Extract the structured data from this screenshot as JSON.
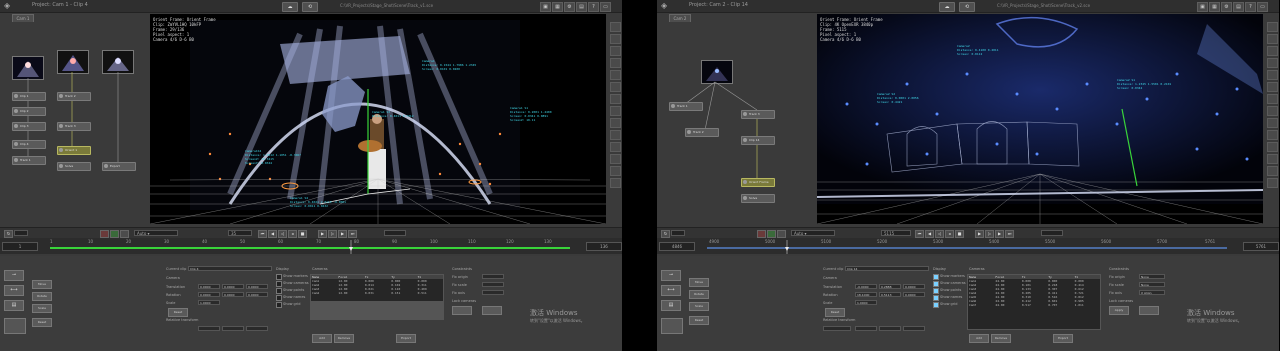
{
  "left": {
    "title": "Project: Cam 1 - Clip 4",
    "file": "C:\\VR_Projects\\Stage_Shot\\Scene\\Track_v1.sce",
    "subtab": "Cam 1",
    "timecode": "35",
    "frame_start": "1",
    "frame_end": "136",
    "ruler": [
      "1",
      "10",
      "20",
      "30",
      "40",
      "50",
      "60",
      "70",
      "80",
      "90",
      "100",
      "110",
      "120",
      "130",
      "136"
    ],
    "viewer_info": [
      "Orient Frame: Orient Frame",
      "Clip: ZmYVL1HQ 10kFP",
      "Frame: 29/136",
      "Pixel aspect: 1",
      "Camera 4/6 D-6 B0"
    ],
    "annotations": [
      "Camera1\nDistance: 0.1544 1.7986 1.2345\nScreen: 0.0101 0.0200",
      "Camera1 S1\nDistance: 0.2001 1.4400\nScreen: 0.0341 0.0891\nScreenZ: 10.11",
      "Camera1S2\nDistance: 1.9512 1.1051 -0.3067\nScreenZ: 10.3415\nScreenY: 0.0344",
      "Camera1 S3\nDistance: 0.4011 0.5312",
      "Camera1 S4\nDistance: 0.4021 2.0110 -0.0001\nScreen: 0.0011 0.0432"
    ],
    "nodes": [
      "Clip 1",
      "Clip 2",
      "Clip 3",
      "Clip 4",
      "Track 1",
      "Track 2",
      "Track 3",
      "Orient 1",
      "Solve",
      "Export"
    ],
    "props": {
      "current_clip_label": "Current clip",
      "current_clip": "Clip 4",
      "camera_label": "Camera",
      "translation_label": "Translation",
      "rotation_label": "Rotation",
      "scale_label": "Scale",
      "reset": "Reset",
      "relative_label": "Relative transform",
      "translation_x": "0.0000",
      "translation_y": "0.0000",
      "translation_z": "0.0000",
      "rot_x": "0.0000",
      "rot_y": "0.0000",
      "rot_z": "0.0000",
      "scale": "1.0000",
      "display_header": "Display",
      "display_items": [
        "Show markers",
        "Show cameras",
        "Show points",
        "Show names",
        "Show grid"
      ],
      "camera_table_header": "Cameras",
      "table_head": [
        "Name",
        "Focal",
        "Tx",
        "Ty",
        "Tz"
      ],
      "table_rows": [
        [
          "Cam1",
          "12.00",
          "0.000",
          "0.000",
          "0.000"
        ],
        [
          "Cam2",
          "12.00",
          "0.014",
          "0.102",
          "0.311"
        ],
        [
          "Cam3",
          "12.00",
          "0.021",
          "0.110",
          "0.409"
        ],
        [
          "Cam4",
          "12.00",
          "0.031",
          "0.151",
          "0.511"
        ]
      ],
      "table_btns": [
        "Add",
        "Remove",
        "Export"
      ],
      "constraints_header": "Constraints",
      "constraint_rows": [
        "Fix origin",
        "Fix scale",
        "Fix axis",
        "Lock cameras"
      ],
      "side_buttons": [
        "Move",
        "Rotate",
        "Scale",
        "Reset"
      ]
    }
  },
  "right": {
    "title": "Project: Cam 2 - Clip 14",
    "file": "C:\\VR_Projects\\Stage_Shot\\Scene\\Track_v2.sce",
    "subtab": "Cam 2",
    "timecode": "5115",
    "frame_start": "4846",
    "frame_end": "5761",
    "ruler": [
      "4900",
      "5000",
      "5100",
      "5200",
      "5300",
      "5400",
      "5500",
      "5600",
      "5700",
      "5761"
    ],
    "viewer_info": [
      "Orient Frame: Orient Frame",
      "Clip: 4K OpenEXR 3840p",
      "Frame: 5115",
      "Pixel aspect: 1",
      "Camera 4/6 D-6 B0"
    ],
    "annotations": [
      "Camera2\nDistance: 0.4100 0.2011\nScreen: 0.0112",
      "Camera2 S1\nDistance: 1.2345 1.5501 0.2101\nScreen: 0.0342",
      "Camera2 S2\nDistance: 0.0001 2.0056\nScreen: 0.4421"
    ],
    "nodes": [
      "Clip 14",
      "Track 1",
      "Track 2",
      "Track 3",
      "Orient Frame",
      "Solve"
    ],
    "props": {
      "current_clip_label": "Current clip",
      "current_clip": "Clip 14",
      "camera_label": "Camera",
      "translation_label": "Translation",
      "rotation_label": "Rotation",
      "scale_label": "Scale",
      "reset": "Reset",
      "relative_label": "Relative transform",
      "translation_x": "-0.0000",
      "translation_y": "0.2888",
      "translation_z": "0.0000",
      "rot_x": "18.1000",
      "rot_y": "0.5113",
      "rot_z": "0.0000",
      "scale": "1.0000",
      "display_header": "Display",
      "display_items": [
        "Show markers",
        "Show cameras",
        "Show points",
        "Show names",
        "Show grid"
      ],
      "camera_table_header": "Cameras",
      "table_head": [
        "Name",
        "Focal",
        "Tx",
        "Ty",
        "Tz"
      ],
      "table_rows": [
        [
          "Cam1",
          "24.00",
          "0.000",
          "0.000",
          "0.000"
        ],
        [
          "Cam2",
          "24.00",
          "0.101",
          "0.218",
          "0.414"
        ],
        [
          "Cam3",
          "24.00",
          "0.133",
          "0.307",
          "0.612"
        ],
        [
          "Cam4",
          "24.00",
          "0.205",
          "0.411",
          "0.721"
        ],
        [
          "Cam5",
          "24.00",
          "0.310",
          "0.516",
          "0.812"
        ],
        [
          "Cam6",
          "24.00",
          "0.412",
          "0.601",
          "0.905"
        ],
        [
          "Cam7",
          "24.00",
          "0.517",
          "0.707",
          "1.011"
        ]
      ],
      "table_btns": [
        "Add",
        "Remove",
        "Export"
      ],
      "constraints_header": "Constraints",
      "constraint_rows": [
        "Fix origin",
        "Fix scale",
        "Fix axis",
        "Lock cameras"
      ],
      "constraint_opts": [
        "None",
        "None",
        "X Align"
      ],
      "apply_btn": "Apply",
      "side_buttons": [
        "Move",
        "Rotate",
        "Scale",
        "Reset"
      ]
    }
  },
  "watermark": {
    "line1": "激活 Windows",
    "line2": "转到\"设置\"以激活 Windows。"
  },
  "colors": {
    "accent_green": "#39d43a",
    "cyan_annotation": "#40d8e8",
    "node_highlight": "#b8b860"
  }
}
